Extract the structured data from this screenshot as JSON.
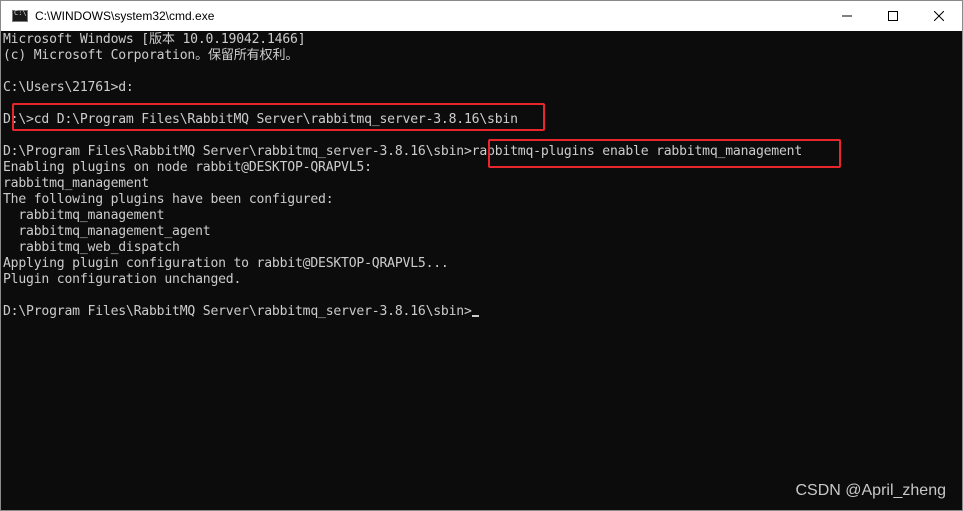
{
  "window": {
    "title": "C:\\WINDOWS\\system32\\cmd.exe",
    "minimize_icon": "minimize-icon",
    "maximize_icon": "maximize-icon",
    "close_icon": "close-icon"
  },
  "console": {
    "lines": [
      "Microsoft Windows [版本 10.0.19042.1466]",
      "(c) Microsoft Corporation。保留所有权利。",
      "",
      "C:\\Users\\21761>d:",
      "",
      "D:\\>cd D:\\Program Files\\RabbitMQ Server\\rabbitmq_server-3.8.16\\sbin",
      "",
      "D:\\Program Files\\RabbitMQ Server\\rabbitmq_server-3.8.16\\sbin>rabbitmq-plugins enable rabbitmq_management",
      "Enabling plugins on node rabbit@DESKTOP-QRAPVL5:",
      "rabbitmq_management",
      "The following plugins have been configured:",
      "  rabbitmq_management",
      "  rabbitmq_management_agent",
      "  rabbitmq_web_dispatch",
      "Applying plugin configuration to rabbit@DESKTOP-QRAPVL5...",
      "Plugin configuration unchanged.",
      "",
      "D:\\Program Files\\RabbitMQ Server\\rabbitmq_server-3.8.16\\sbin>"
    ]
  },
  "watermark": "CSDN @April_zheng",
  "colors": {
    "console_bg": "#0c0c0c",
    "console_text": "#cccccc",
    "highlight": "#e8262c"
  }
}
